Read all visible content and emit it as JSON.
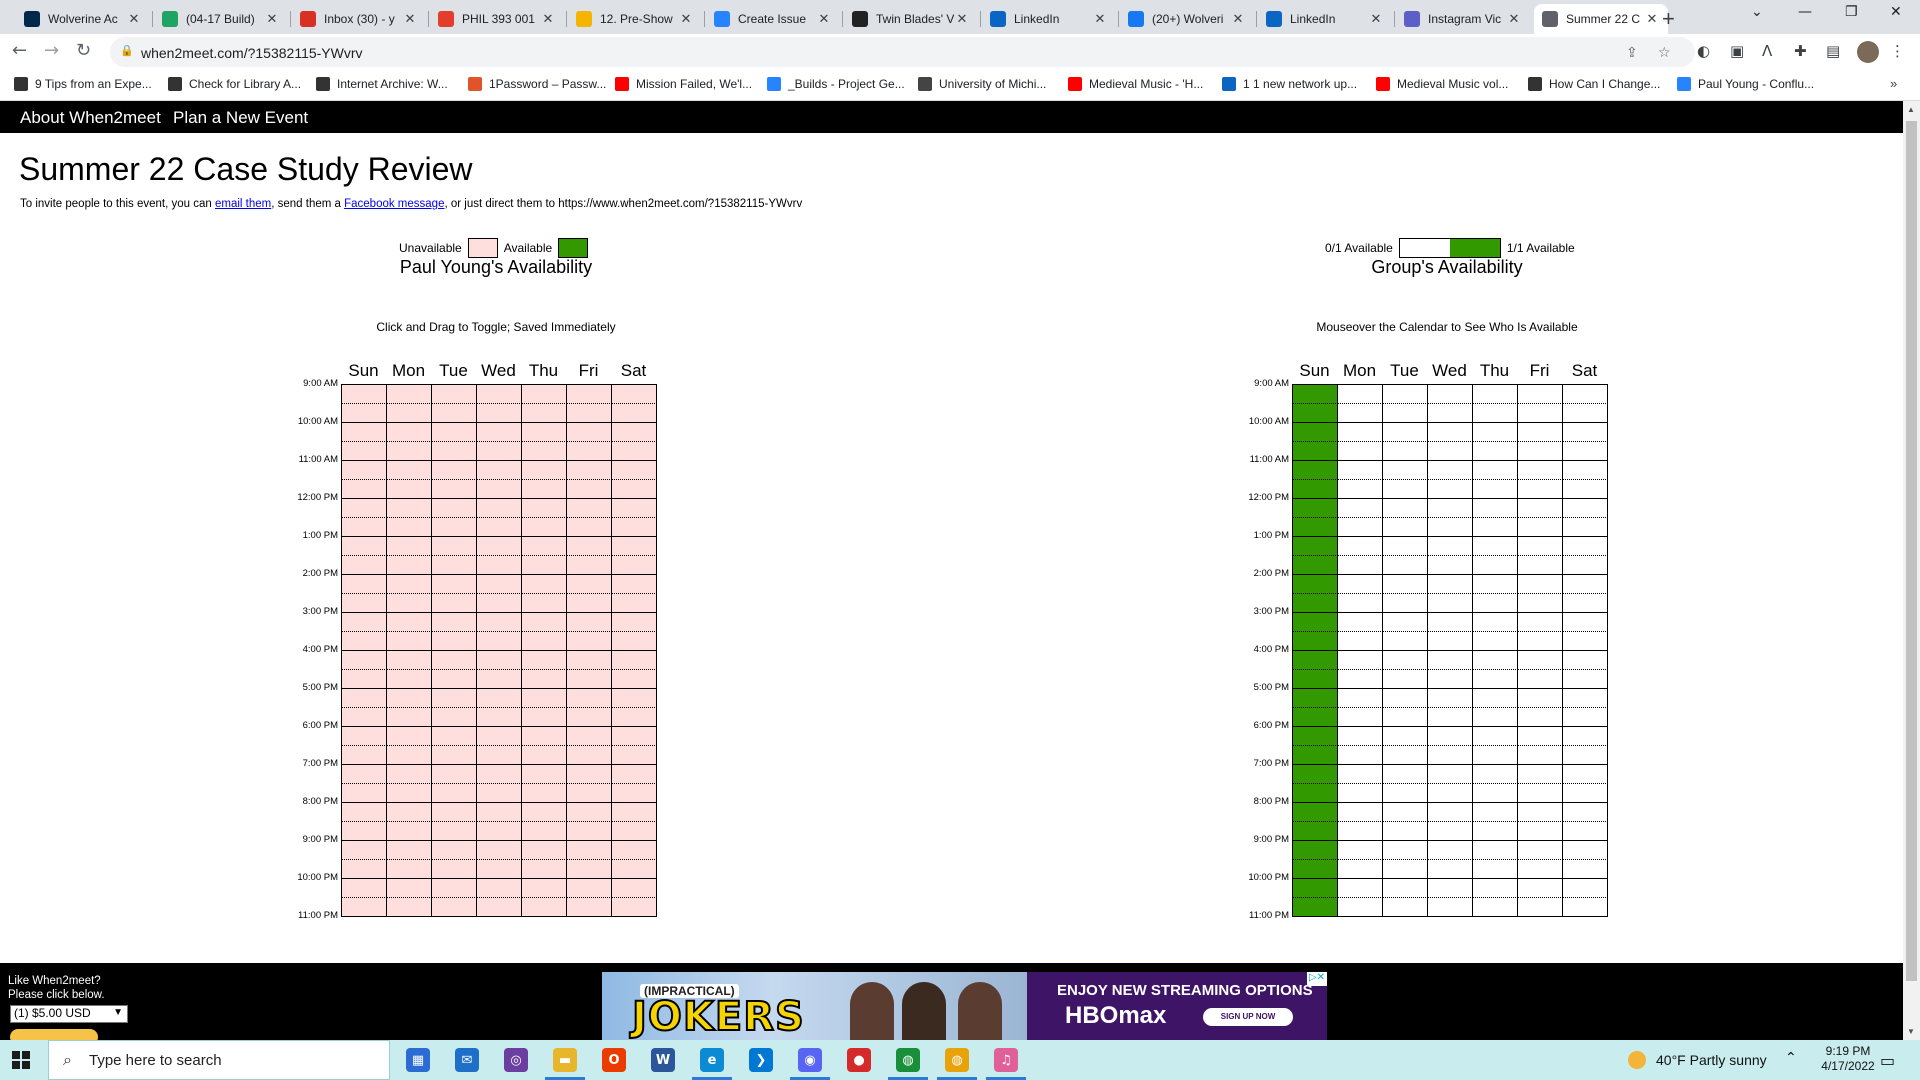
{
  "browser": {
    "tabs": [
      {
        "title": "Wolverine Ac",
        "icon": "michigan-m-icon",
        "color": "#00274c"
      },
      {
        "title": "(04-17 Build)",
        "icon": "google-drive-icon",
        "color": "#1fa463"
      },
      {
        "title": "Inbox (30) - y",
        "icon": "gmail-icon",
        "color": "#d93025"
      },
      {
        "title": "PHIL 393 001",
        "icon": "canvas-icon",
        "color": "#e33e2b"
      },
      {
        "title": "12. Pre-Show",
        "icon": "google-slides-icon",
        "color": "#f4b400"
      },
      {
        "title": "Create Issue",
        "icon": "jira-icon",
        "color": "#2684ff"
      },
      {
        "title": "Twin Blades' V",
        "icon": "game-icon",
        "color": "#222222"
      },
      {
        "title": "LinkedIn",
        "icon": "linkedin-icon",
        "color": "#0a66c2"
      },
      {
        "title": "(20+) Wolveri",
        "icon": "facebook-icon",
        "color": "#1877f2"
      },
      {
        "title": "LinkedIn",
        "icon": "linkedin-icon",
        "color": "#0a66c2"
      },
      {
        "title": "Instagram Vic",
        "icon": "teams-icon",
        "color": "#5b5fc7"
      },
      {
        "title": "Summer 22 C",
        "icon": "clock-icon",
        "color": "#5f6368"
      }
    ],
    "url": "when2meet.com/?15382115-YWvrv",
    "bookmarks": [
      {
        "label": "9 Tips from an Expe...",
        "color": "#333333"
      },
      {
        "label": "Check for Library A...",
        "color": "#333333"
      },
      {
        "label": "Internet Archive: W...",
        "color": "#333333"
      },
      {
        "label": "1Password – Passw...",
        "color": "#e0542a"
      },
      {
        "label": "Mission Failed, We'l...",
        "color": "#ff0000"
      },
      {
        "label": "_Builds - Project Ge...",
        "color": "#2684ff"
      },
      {
        "label": "University of Michi...",
        "color": "#444444"
      },
      {
        "label": "Medieval Music - 'H...",
        "color": "#ff0000"
      },
      {
        "label": "1 1 new network up...",
        "color": "#0a66c2"
      },
      {
        "label": "Medieval Music vol...",
        "color": "#ff0000"
      },
      {
        "label": "How Can I Change...",
        "color": "#333333"
      },
      {
        "label": "Paul Young - Conflu...",
        "color": "#2684ff"
      }
    ]
  },
  "site": {
    "nav": [
      "About When2meet",
      "Plan a New Event"
    ],
    "title": "Summer 22 Case Study Review",
    "invite": {
      "prefix": "To invite people to this event, you can ",
      "email_link": "email them",
      "middle": ", send them a ",
      "fb_link": "Facebook message",
      "suffix": ", or just direct them to https://www.when2meet.com/?15382115-YWvrv"
    },
    "personal": {
      "title": "Paul Young's Availability",
      "unavailable_label": "Unavailable",
      "available_label": "Available",
      "hint": "Click and Drag to Toggle; Saved Immediately",
      "unavailable_color": "#ffdede",
      "available_color": "#339900"
    },
    "group": {
      "title": "Group's Availability",
      "min_label": "0/1 Available",
      "max_label": "1/1 Available",
      "hint": "Mouseover the Calendar to See Who Is Available",
      "empty_color": "#ffffff",
      "full_color": "#339900"
    },
    "days": [
      "Sun",
      "Mon",
      "Tue",
      "Wed",
      "Thu",
      "Fri",
      "Sat"
    ],
    "times": [
      "9:00 AM",
      "10:00 AM",
      "11:00 AM",
      "12:00 PM",
      "1:00 PM",
      "2:00 PM",
      "3:00 PM",
      "4:00 PM",
      "5:00 PM",
      "6:00 PM",
      "7:00 PM",
      "8:00 PM",
      "9:00 PM",
      "10:00 PM",
      "11:00 PM"
    ],
    "group_available_days": [
      "Sun"
    ],
    "footer": {
      "donate_line1": "Like When2meet?",
      "donate_line2": "Please click below.",
      "donate_option": "(1) $5.00 USD",
      "ad_show": "(IMPRACTICAL)",
      "ad_title": "JOKERS",
      "ad_tagline": "ENJOY NEW STREAMING OPTIONS",
      "ad_brand": "HBOmax",
      "ad_button": "SIGN UP NOW"
    }
  },
  "taskbar": {
    "search_placeholder": "Type here to search",
    "weather": "40°F  Partly sunny",
    "time": "9:19 PM",
    "date": "4/17/2022",
    "apps": [
      {
        "name": "store-icon",
        "color": "#2b6cd4",
        "glyph": "▦"
      },
      {
        "name": "mail-icon",
        "color": "#1e6fc8",
        "glyph": "✉"
      },
      {
        "name": "github-desktop-icon",
        "color": "#6b3fa0",
        "glyph": "◎"
      },
      {
        "name": "file-explorer-icon",
        "color": "#e8b62a",
        "glyph": "▬"
      },
      {
        "name": "office-icon",
        "color": "#eb3c00",
        "glyph": "O"
      },
      {
        "name": "word-icon",
        "color": "#2b579a",
        "glyph": "W"
      },
      {
        "name": "edge-icon",
        "color": "#0c8ad3",
        "glyph": "e"
      },
      {
        "name": "vscode-icon",
        "color": "#0078d4",
        "glyph": "❯"
      },
      {
        "name": "discord-icon",
        "color": "#5865f2",
        "glyph": "◉"
      },
      {
        "name": "record-icon",
        "color": "#d42a2a",
        "glyph": "●"
      },
      {
        "name": "chrome-icon",
        "color": "#1a8f3a",
        "glyph": "◍"
      },
      {
        "name": "chrome-alt-icon",
        "color": "#e8a20a",
        "glyph": "◍"
      },
      {
        "name": "itunes-icon",
        "color": "#e0609a",
        "glyph": "♫"
      }
    ]
  }
}
